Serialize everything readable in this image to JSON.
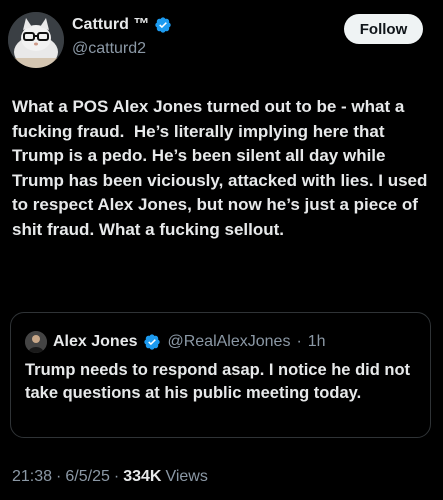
{
  "author": {
    "name": "Catturd ™",
    "handle": "@catturd2"
  },
  "follow_label": "Follow",
  "tweet_text": "What a POS Alex Jones turned out to be - what a fucking fraud.  He’s literally implying here that Trump is a pedo. He’s been silent all day while Trump has been viciously, attacked with lies. I used to respect Alex Jones, but now he’s just a piece of shit fraud. What a fucking sellout.",
  "quote": {
    "name": "Alex Jones",
    "handle": "@RealAlexJones",
    "separator": "·",
    "time": "1h",
    "text": "Trump needs to respond asap. I notice he did not take questions at his public meeting today."
  },
  "meta": {
    "time": "21:38",
    "sep1": "·",
    "date": "6/5/25",
    "sep2": "·",
    "views_count": "334K",
    "views_label": "Views"
  },
  "colors": {
    "background": "#000000",
    "text": "#e7e9ea",
    "secondary": "#8b98a5",
    "verified_blue": "#1d9bf0",
    "border": "#2f3336"
  },
  "icons": {
    "verified": "verified-badge-icon"
  }
}
